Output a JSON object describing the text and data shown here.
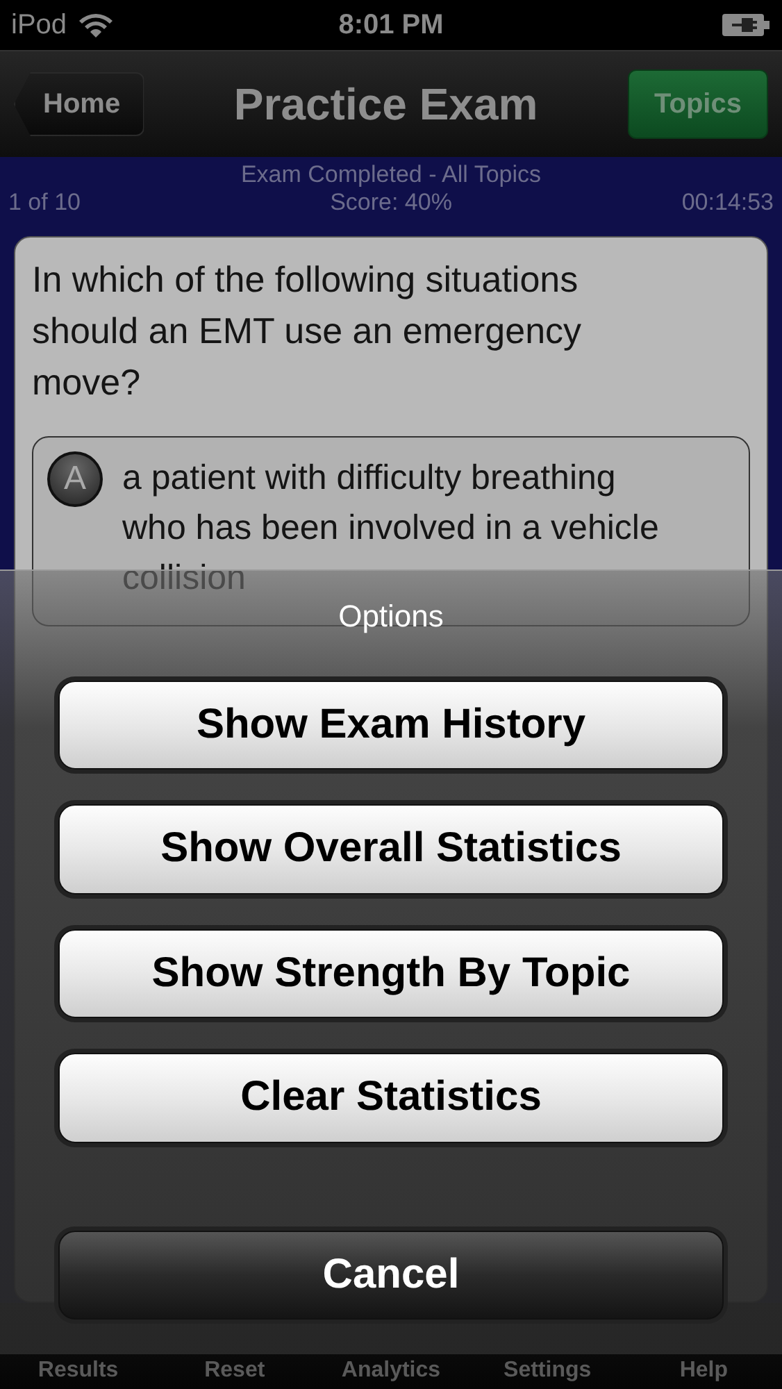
{
  "status_bar": {
    "carrier": "iPod",
    "time": "8:01 PM"
  },
  "nav_bar": {
    "back_button": "Home",
    "title": "Practice Exam",
    "right_button": "Topics"
  },
  "exam_info": {
    "status": "Exam Completed - All Topics",
    "position": "1 of 10",
    "score": "Score: 40%",
    "timer": "00:14:53"
  },
  "question": {
    "text": "In which of the following situations should an EMT use an emergency move?",
    "answers": [
      {
        "letter": "A",
        "text": "a patient with difficulty breathing who has been involved in a vehicle collision"
      }
    ]
  },
  "tab_bar": {
    "items": [
      {
        "label": "Results"
      },
      {
        "label": "Reset"
      },
      {
        "label": "Analytics"
      },
      {
        "label": "Settings"
      },
      {
        "label": "Help"
      }
    ]
  },
  "action_sheet": {
    "title": "Options",
    "buttons": [
      {
        "label": "Show Exam History",
        "kind": "option"
      },
      {
        "label": "Show Overall Statistics",
        "kind": "option"
      },
      {
        "label": "Show Strength By Topic",
        "kind": "option"
      },
      {
        "label": "Clear Statistics",
        "kind": "option"
      },
      {
        "label": "Cancel",
        "kind": "cancel"
      }
    ]
  }
}
